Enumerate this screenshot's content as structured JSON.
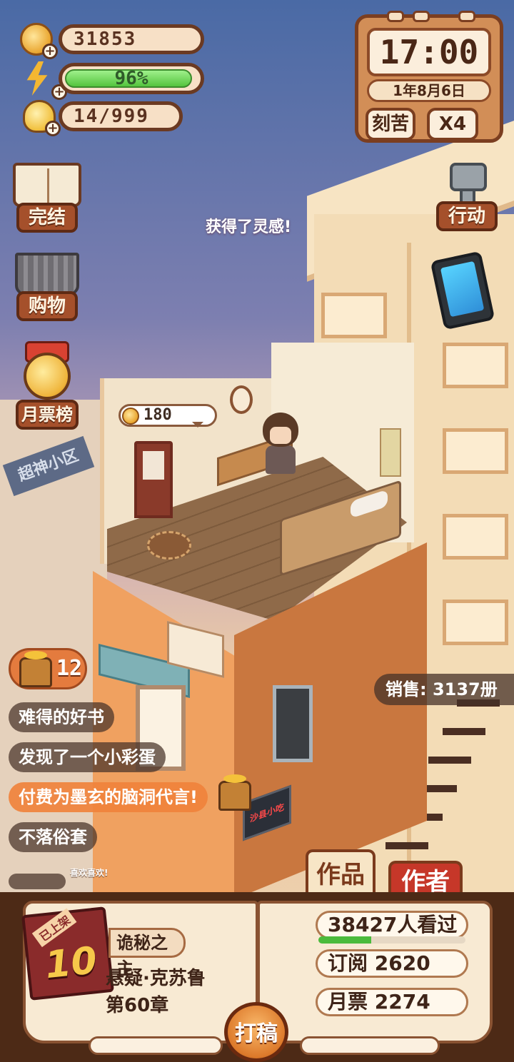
{
  "stats": {
    "coins": "31853",
    "energy_text": "96%",
    "energy_fraction": 0.96,
    "inspiration": "14/999"
  },
  "clock": {
    "time": "17:00",
    "date": "1年8月6日",
    "mode_button": "刻苦",
    "speed_button": "X4"
  },
  "left_menu": {
    "finish": "完结",
    "shop": "购物",
    "ranking": "月票榜"
  },
  "right_menu": {
    "action": "行动"
  },
  "scene": {
    "float_message": "获得了灵感!",
    "coin_bubble_value": "180",
    "community_sign": "超神小区",
    "neon_sign": "沙县小吃"
  },
  "comments": {
    "chest_count": "12",
    "items": [
      "难得的好书",
      "发现了一个小彩蛋",
      "付费为墨玄的脑洞代言!",
      "不落俗套"
    ],
    "tiny_message": "喜欢喜欢!"
  },
  "sales_text": "销售: 3137册",
  "tabs": {
    "works": "作品",
    "author": "作者"
  },
  "book": {
    "status_tag": "已上架",
    "level": "10",
    "title": "诡秘之主",
    "genre": "悬疑·克苏鲁",
    "chapter": "第60章",
    "views": "38427人看过",
    "views_progress": 0.36,
    "subscriptions": "订阅 2620",
    "monthly_tickets": "月票 2274"
  },
  "write_button": "打稿",
  "colors": {
    "panel_brown": "#6b3a22",
    "accent_orange": "#dd7a2b",
    "author_red": "#c63729",
    "energy_green": "#54c43e"
  }
}
